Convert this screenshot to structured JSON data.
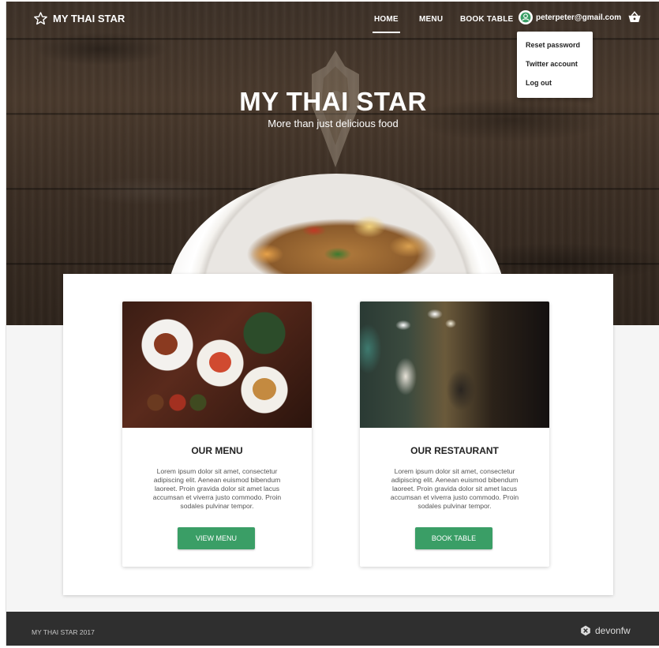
{
  "header": {
    "brand": "MY THAI STAR",
    "nav": [
      {
        "label": "HOME",
        "active": true
      },
      {
        "label": "MENU",
        "active": false
      },
      {
        "label": "BOOK TABLE",
        "active": false
      }
    ],
    "user_email": "peterpeter@gmail.com",
    "user_icon": "user-circle-icon",
    "cart_icon": "basket-icon"
  },
  "user_menu": {
    "items": [
      "Reset password",
      "Twitter account",
      "Log out"
    ]
  },
  "hero": {
    "title": "MY THAI STAR",
    "subtitle": "More than just delicious food"
  },
  "features": [
    {
      "title": "OUR MENU",
      "text": "Lorem ipsum dolor sit amet, consectetur adipiscing elit. Aenean euismod bibendum laoreet. Proin gravida dolor sit amet lacus accumsan et viverra justo commodo. Proin sodales pulvinar tempor.",
      "button": "VIEW MENU"
    },
    {
      "title": "OUR RESTAURANT",
      "text": "Lorem ipsum dolor sit amet, consectetur adipiscing elit. Aenean euismod bibendum laoreet. Proin gravida dolor sit amet lacus accumsan et viverra justo commodo. Proin sodales pulvinar tempor.",
      "button": "BOOK TABLE"
    }
  ],
  "footer": {
    "copyright": "MY THAI STAR 2017",
    "logo_text": "devonfw"
  },
  "colors": {
    "accent_green": "#3a9e66",
    "footer_bg": "#2f2f2f"
  }
}
